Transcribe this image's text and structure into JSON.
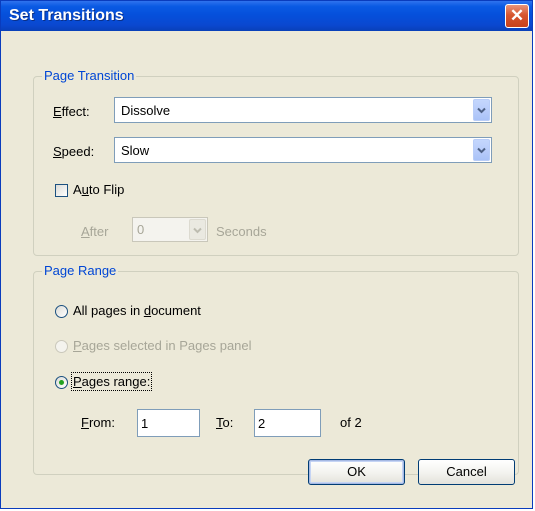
{
  "dialog": {
    "title": "Set Transitions",
    "close_glyph": "✕"
  },
  "page_transition": {
    "legend": "Page Transition",
    "effect": {
      "label_key": "E",
      "label_rest": "ffect:",
      "value": "Dissolve"
    },
    "speed": {
      "label_key": "S",
      "label_rest": "peed:",
      "value": "Slow"
    },
    "auto_flip": {
      "label_pre": "A",
      "label_key": "u",
      "label_rest": "to Flip",
      "checked": false
    },
    "after": {
      "label_key": "A",
      "label_rest": "fter",
      "value": "0",
      "suffix": "Seconds"
    }
  },
  "page_range": {
    "legend": "Page Range",
    "all_pages": {
      "label_pre": "All pages in ",
      "label_key": "d",
      "label_rest": "ocument",
      "selected": false
    },
    "pages_selected": {
      "label_key": "P",
      "label_rest": "ages selected in Pages panel",
      "selected": false,
      "enabled": false
    },
    "pages_range": {
      "label_key": "P",
      "label_rest": "ages range:",
      "selected": true
    },
    "from": {
      "label_key": "F",
      "label_rest": "rom:",
      "value": "1"
    },
    "to": {
      "label_key": "T",
      "label_rest": "o:",
      "value": "2"
    },
    "of_text": "of 2"
  },
  "buttons": {
    "ok": "OK",
    "cancel": "Cancel"
  },
  "colors": {
    "titlebar": "#0550db",
    "legend_text": "#0046d5",
    "dialog_bg": "#ece9d8",
    "close_button": "#d7562f",
    "radio_dot": "#21a121"
  },
  "icons": {
    "close": "close-icon",
    "dropdown": "chevron-down-icon"
  }
}
